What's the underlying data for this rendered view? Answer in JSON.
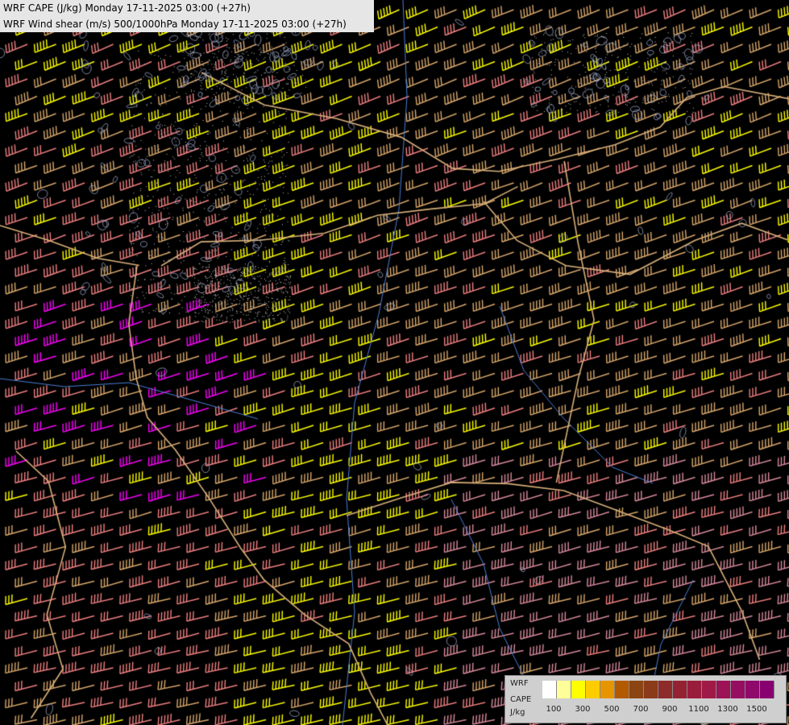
{
  "header": {
    "title_cape": "WRF CAPE (J/kg) Monday 17-11-2025 03:00 (+27h)",
    "title_shear": "WRF Wind shear (m/s) 500/1000hPa Monday 17-11-2025 03:00 (+27h)"
  },
  "legend": {
    "line1": "WRF",
    "line2": "CAPE",
    "unit": "J/kg",
    "colors": [
      "#ffffff",
      "#ffff99",
      "#ffff00",
      "#ffcc00",
      "#e69500",
      "#b35900",
      "#8b4513",
      "#8b3a1a",
      "#8e2b2b",
      "#952233",
      "#9a1c3c",
      "#a01a48",
      "#9c1356",
      "#950e62",
      "#8f0a6a",
      "#880070"
    ],
    "ticks": [
      "100",
      "300",
      "500",
      "700",
      "900",
      "1100",
      "1300",
      "1500"
    ]
  },
  "map": {
    "barb_colors": {
      "yellow": "#ffff00",
      "tan": "#d9a86c",
      "salmon": "#f08080",
      "magenta": "#ff00ff",
      "pink": "#d88b9b"
    },
    "boundary_color": "#d9b07a",
    "river_color": "#4a7fd6",
    "terrain_contour_color": "#9aa6c8"
  }
}
